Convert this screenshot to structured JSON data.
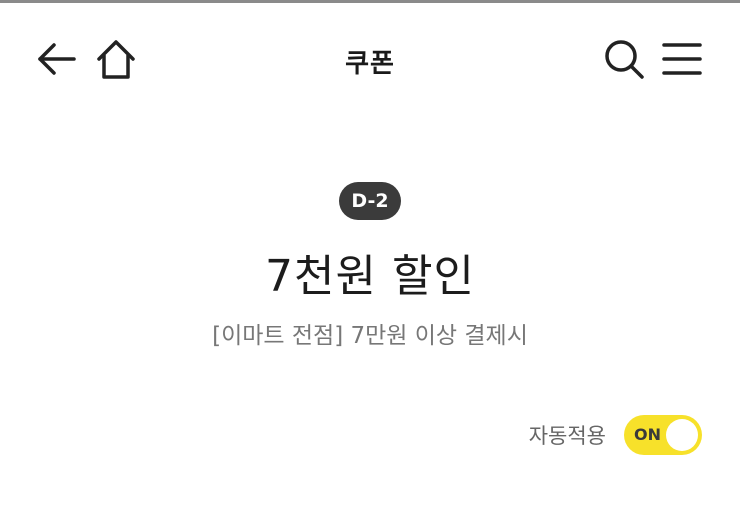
{
  "header": {
    "title": "쿠폰",
    "icons": {
      "back": "arrow-left-icon",
      "home": "home-icon",
      "search": "search-icon",
      "menu": "hamburger-menu-icon"
    }
  },
  "coupon": {
    "dday_badge": "D-2",
    "title": "7천원 할인",
    "description": "[이마트 전점] 7만원 이상 결제시"
  },
  "auto_apply": {
    "label": "자동적용",
    "toggle_text": "ON",
    "state": "on",
    "toggle_color": "#f7e12a"
  },
  "colors": {
    "badge_bg": "#3b3b3b",
    "accent_yellow": "#f7e12a"
  }
}
